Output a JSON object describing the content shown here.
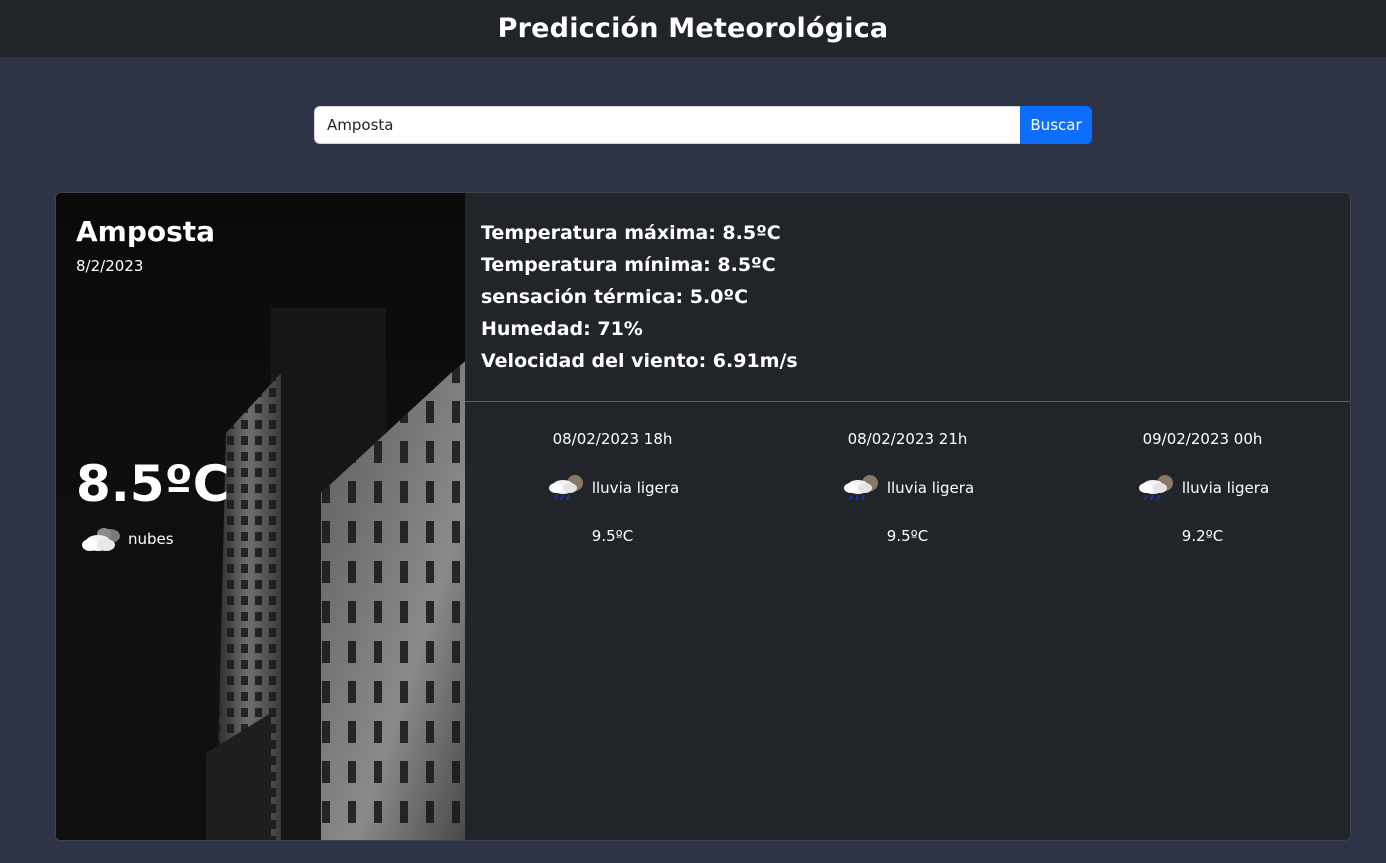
{
  "header": {
    "title": "Predicción Meteorológica"
  },
  "search": {
    "value": "Amposta",
    "button_label": "Buscar"
  },
  "current": {
    "city": "Amposta",
    "date": "8/2/2023",
    "temperature": "8.5ºC",
    "condition": "nubes",
    "condition_icon": "clouds-icon"
  },
  "details": {
    "max_temp": "Temperatura máxima: 8.5ºC",
    "min_temp": "Temperatura mínima: 8.5ºC",
    "feels_like": "sensación térmica: 5.0ºC",
    "humidity": "Humedad: 71%",
    "wind": "Velocidad del viento: 6.91m/s"
  },
  "forecast": [
    {
      "datetime": "08/02/2023 18h",
      "description": "lluvia ligera",
      "icon": "light-rain-icon",
      "temp": "9.5ºC"
    },
    {
      "datetime": "08/02/2023 21h",
      "description": "lluvia ligera",
      "icon": "light-rain-icon",
      "temp": "9.5ºC"
    },
    {
      "datetime": "09/02/2023 00h",
      "description": "lluvia ligera",
      "icon": "light-rain-icon",
      "temp": "9.2ºC"
    }
  ],
  "colors": {
    "page_bg": "#2e3446",
    "topbar_bg": "#212429",
    "card_bg": "#212429",
    "button_bg": "#0d6efd"
  }
}
